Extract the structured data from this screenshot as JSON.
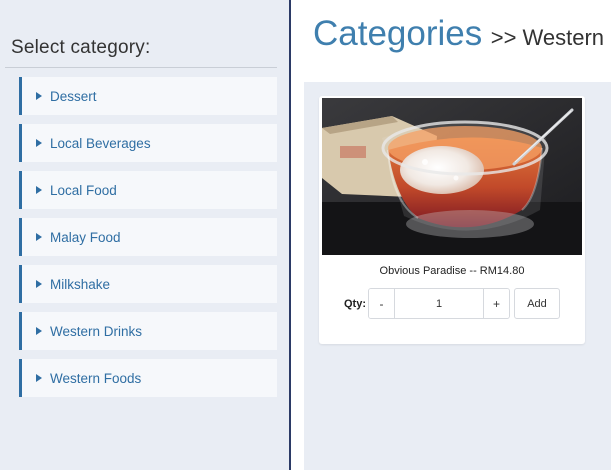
{
  "sidebar": {
    "title": "Select category:",
    "items": [
      {
        "label": "Dessert"
      },
      {
        "label": "Local Beverages"
      },
      {
        "label": "Local Food"
      },
      {
        "label": "Malay Food"
      },
      {
        "label": "Milkshake"
      },
      {
        "label": "Western Drinks"
      },
      {
        "label": "Western Foods"
      }
    ]
  },
  "header": {
    "title": "Categories",
    "breadcrumb": ">> Western"
  },
  "product": {
    "name_price": "Obvious Paradise -- RM14.80",
    "qty_label": "Qty:",
    "minus_label": "-",
    "quantity": "1",
    "plus_label": "+",
    "add_label": "Add"
  },
  "colors": {
    "accent": "#2f6ea3",
    "heading": "#3f7fae",
    "divider": "#2b3a66",
    "panel_bg": "#e9edf4"
  }
}
